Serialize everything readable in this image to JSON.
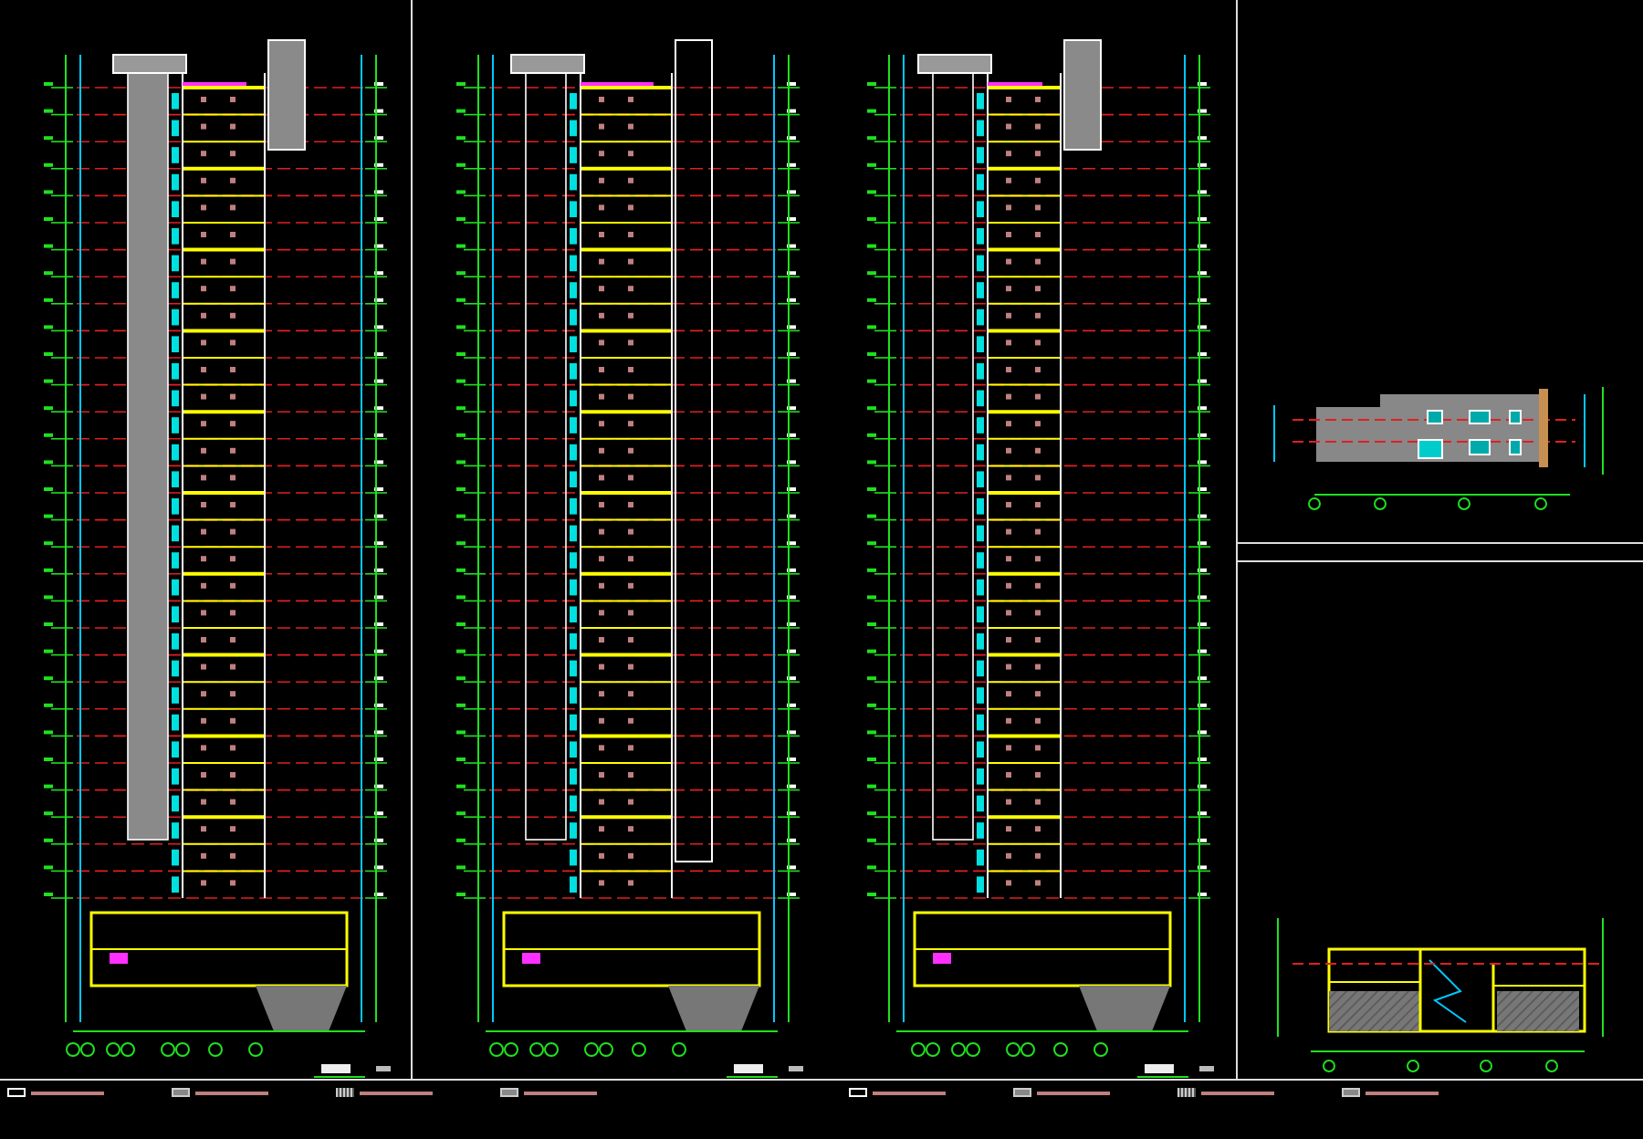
{
  "sheet": {
    "panels": [
      {
        "kind": "tower-section"
      },
      {
        "kind": "tower-section"
      },
      {
        "kind": "tower-section"
      },
      {
        "kind": "elevation"
      },
      {
        "kind": "podium-section"
      }
    ],
    "legend": [
      {
        "kind": "outline"
      },
      {
        "kind": "gray-fill"
      },
      {
        "kind": "dotted-fill"
      },
      {
        "kind": "gray-fill"
      },
      {
        "kind": "outline"
      },
      {
        "kind": "gray-fill"
      },
      {
        "kind": "dotted-fill"
      },
      {
        "kind": "gray-fill"
      }
    ]
  }
}
